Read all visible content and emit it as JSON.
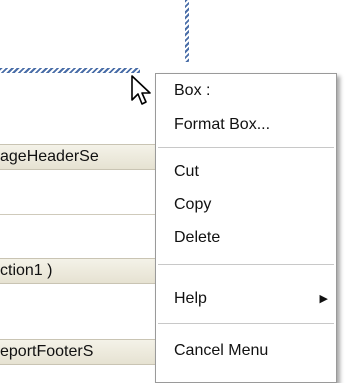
{
  "sections": [
    {
      "label": "ageHeaderSe"
    },
    {
      "label": "ction1 )"
    },
    {
      "label": "eportFooterS"
    }
  ],
  "context_menu": {
    "items": [
      {
        "label": "Box :"
      },
      {
        "label": "Format Box..."
      },
      {
        "label": "Cut"
      },
      {
        "label": "Copy"
      },
      {
        "label": "Delete"
      },
      {
        "label": "Help",
        "submenu_icon": "submenu-arrow-icon"
      },
      {
        "label": "Cancel Menu"
      }
    ]
  },
  "icons": {
    "cursor": "mouse-pointer-icon",
    "submenu_arrow": "▶"
  },
  "colors": {
    "hatch": "#4a6ea8",
    "section_bar": "#eeebdf",
    "menu_border": "#9a9a9a"
  }
}
